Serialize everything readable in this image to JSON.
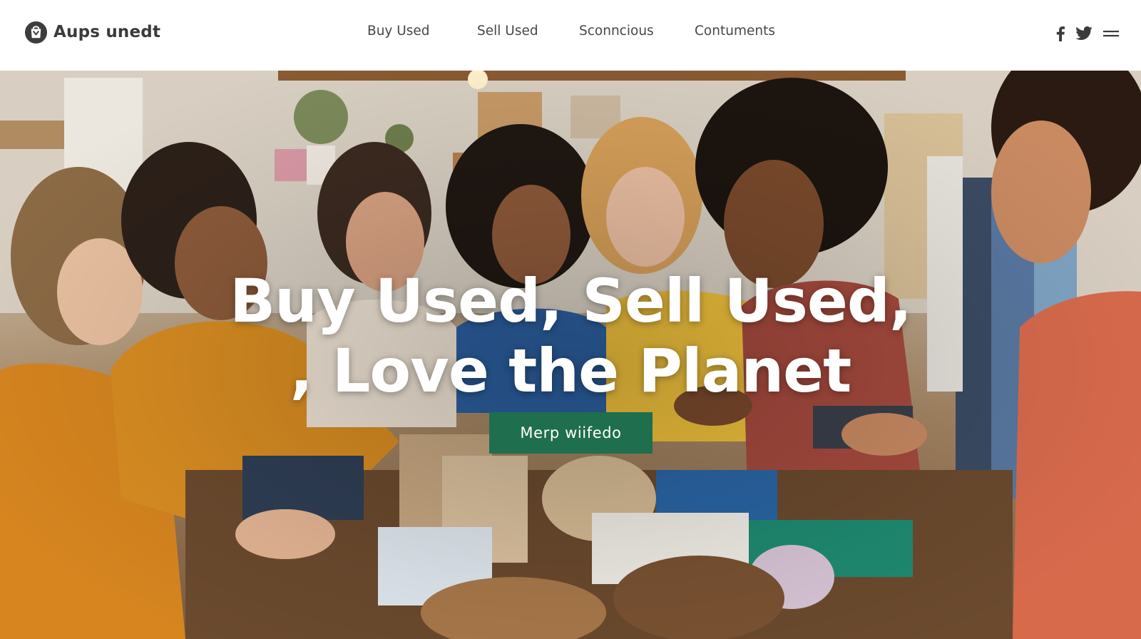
{
  "brand": {
    "name": "Aups unedt",
    "logo_icon": "bag-logo-icon"
  },
  "nav": {
    "items": [
      {
        "label": "Buy Used"
      },
      {
        "label": "Sell Used"
      },
      {
        "label": "Sconncious"
      },
      {
        "label": "Contuments"
      }
    ]
  },
  "social": {
    "icons": [
      "facebook-icon",
      "twitter-icon",
      "menu-icon"
    ]
  },
  "hero": {
    "headline_line1": "Buy Used, Sell Used,",
    "headline_line2": ", Love the Planet",
    "cta_label": "Merp wiifedo",
    "image_description_icon": "hero-photo"
  },
  "colors": {
    "cta_background": "#1f6e4e",
    "nav_text": "#474747",
    "brand_text": "#3a3a3a",
    "headline_text": "#ffffff"
  }
}
